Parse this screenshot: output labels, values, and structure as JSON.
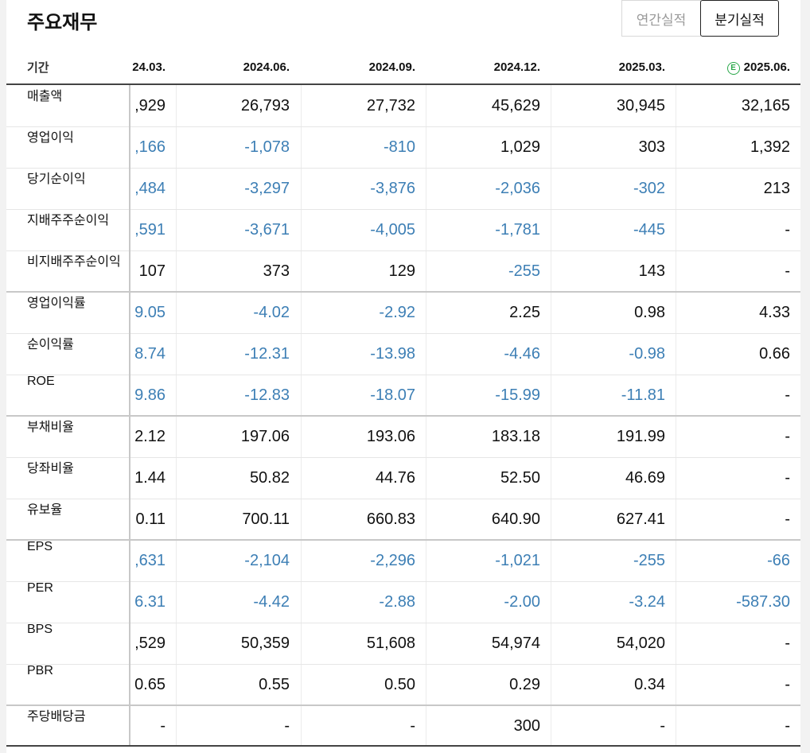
{
  "title": "주요재무",
  "toggle": {
    "annual": "연간실적",
    "quarterly": "분기실적"
  },
  "period_label": "기간",
  "columns": [
    "24.03.",
    "2024.06.",
    "2024.09.",
    "2024.12.",
    "2025.03.",
    "2025.06."
  ],
  "estimate_marker": "E",
  "colors": {
    "negative": "#3d7fb5",
    "estimate": "#2aa84a"
  },
  "rows": [
    {
      "label": "매출액",
      "values": [
        ",929",
        "26,793",
        "27,732",
        "45,629",
        "30,945",
        "32,165"
      ],
      "neg": [
        false,
        false,
        false,
        false,
        false,
        false
      ]
    },
    {
      "label": "영업이익",
      "values": [
        ",166",
        "-1,078",
        "-810",
        "1,029",
        "303",
        "1,392"
      ],
      "neg": [
        true,
        true,
        true,
        false,
        false,
        false
      ]
    },
    {
      "label": "당기순이익",
      "values": [
        ",484",
        "-3,297",
        "-3,876",
        "-2,036",
        "-302",
        "213"
      ],
      "neg": [
        true,
        true,
        true,
        true,
        true,
        false
      ]
    },
    {
      "label": "지배주주순이익",
      "values": [
        ",591",
        "-3,671",
        "-4,005",
        "-1,781",
        "-445",
        "-"
      ],
      "neg": [
        true,
        true,
        true,
        true,
        true,
        false
      ]
    },
    {
      "label": "비지배주주순이익",
      "values": [
        "107",
        "373",
        "129",
        "-255",
        "143",
        "-"
      ],
      "neg": [
        false,
        false,
        false,
        true,
        false,
        false
      ]
    },
    {
      "label": "영업이익률",
      "values": [
        "9.05",
        "-4.02",
        "-2.92",
        "2.25",
        "0.98",
        "4.33"
      ],
      "neg": [
        true,
        true,
        true,
        false,
        false,
        false
      ]
    },
    {
      "label": "순이익률",
      "values": [
        "8.74",
        "-12.31",
        "-13.98",
        "-4.46",
        "-0.98",
        "0.66"
      ],
      "neg": [
        true,
        true,
        true,
        true,
        true,
        false
      ]
    },
    {
      "label": "ROE",
      "values": [
        "9.86",
        "-12.83",
        "-18.07",
        "-15.99",
        "-11.81",
        "-"
      ],
      "neg": [
        true,
        true,
        true,
        true,
        true,
        false
      ]
    },
    {
      "label": "부채비율",
      "values": [
        "2.12",
        "197.06",
        "193.06",
        "183.18",
        "191.99",
        "-"
      ],
      "neg": [
        false,
        false,
        false,
        false,
        false,
        false
      ]
    },
    {
      "label": "당좌비율",
      "values": [
        "1.44",
        "50.82",
        "44.76",
        "52.50",
        "46.69",
        "-"
      ],
      "neg": [
        false,
        false,
        false,
        false,
        false,
        false
      ]
    },
    {
      "label": "유보율",
      "values": [
        "0.11",
        "700.11",
        "660.83",
        "640.90",
        "627.41",
        "-"
      ],
      "neg": [
        false,
        false,
        false,
        false,
        false,
        false
      ]
    },
    {
      "label": "EPS",
      "values": [
        ",631",
        "-2,104",
        "-2,296",
        "-1,021",
        "-255",
        "-66"
      ],
      "neg": [
        true,
        true,
        true,
        true,
        true,
        true
      ]
    },
    {
      "label": "PER",
      "values": [
        "6.31",
        "-4.42",
        "-2.88",
        "-2.00",
        "-3.24",
        "-587.30"
      ],
      "neg": [
        true,
        true,
        true,
        true,
        true,
        true
      ]
    },
    {
      "label": "BPS",
      "values": [
        ",529",
        "50,359",
        "51,608",
        "54,974",
        "54,020",
        "-"
      ],
      "neg": [
        false,
        false,
        false,
        false,
        false,
        false
      ]
    },
    {
      "label": "PBR",
      "values": [
        "0.65",
        "0.55",
        "0.50",
        "0.29",
        "0.34",
        "-"
      ],
      "neg": [
        false,
        false,
        false,
        false,
        false,
        false
      ]
    },
    {
      "label": "주당배당금",
      "values": [
        "-",
        "-",
        "-",
        "300",
        "-",
        "-"
      ],
      "neg": [
        false,
        false,
        false,
        false,
        false,
        false
      ]
    }
  ]
}
